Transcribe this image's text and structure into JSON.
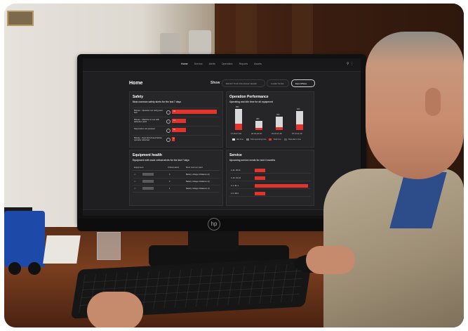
{
  "app": {
    "logo_text": "",
    "nav": [
      "Home",
      "Service",
      "Alerts",
      "Operation",
      "Reports",
      "Assets"
    ],
    "active_nav": "Home",
    "menu_icons": "⚲ ⋮"
  },
  "page": {
    "title": "Home",
    "show_label": "Show",
    "filters": [
      {
        "label": "Electric Truck Interviewer Header"
      },
      {
        "label": "Loader Series"
      },
      {
        "label": "Export/Save"
      }
    ]
  },
  "safety": {
    "title": "Safety",
    "subtitle": "Most common safety alerts for the last 7 days",
    "rows": [
      {
        "label": "Misuse - Operator not using seat belt",
        "value": "44",
        "fraction": 1.0
      },
      {
        "label": "Misuse - Machine in use with defective parts",
        "value": "14",
        "fraction": 0.32
      },
      {
        "label": "Stop button not pressed",
        "value": "10",
        "fraction": 0.32
      },
      {
        "label": "Misuse - Seat belt closed before operator detected",
        "value": "3",
        "fraction": 0.06
      }
    ]
  },
  "operation": {
    "title": "Operation Performance",
    "subtitle": "Operating and idle time for all equipment",
    "legend": [
      "Idle time",
      "Total operating time",
      "Total time",
      "Total alarm time"
    ],
    "chart_data": {
      "type": "bar",
      "categories": [
        "17.10-17.16",
        "24.10-24.16",
        "31.10-11.16",
        "07.11-11.16"
      ],
      "series": [
        {
          "name": "Idle time",
          "values": [
            50,
            24,
            35,
            44
          ]
        },
        {
          "name": "Total operating time",
          "values": [
            22,
            8,
            10,
            20
          ]
        }
      ],
      "value_labels": [
        "80h",
        "38h",
        "46h",
        "64h"
      ]
    }
  },
  "equipment": {
    "title": "Equipment health",
    "subtitle": "Equipment with most critical alerts for the last 7 days",
    "columns": [
      "Equipment",
      "Critical alerts",
      "Most common alert"
    ],
    "rows": [
      {
        "alerts": "4",
        "alert": "Battery voltage imbalance (2)"
      },
      {
        "alerts": "3",
        "alert": "Battery voltage imbalance (2)"
      },
      {
        "alerts": "1",
        "alert": "Battery voltage imbalance (1)"
      }
    ]
  },
  "service": {
    "title": "Service",
    "subtitle": "Upcoming service needs for next 3 months",
    "rows": [
      {
        "label": "1-11..30.11",
        "fraction": 0.2
      },
      {
        "label": "1.12..31.12",
        "fraction": 0.2
      },
      {
        "label": "1.1..31.1",
        "fraction": 1.0
      },
      {
        "label": "1.2..28.2",
        "fraction": 0.2
      }
    ]
  },
  "footer": {
    "brand": "",
    "left": "",
    "right": ""
  }
}
